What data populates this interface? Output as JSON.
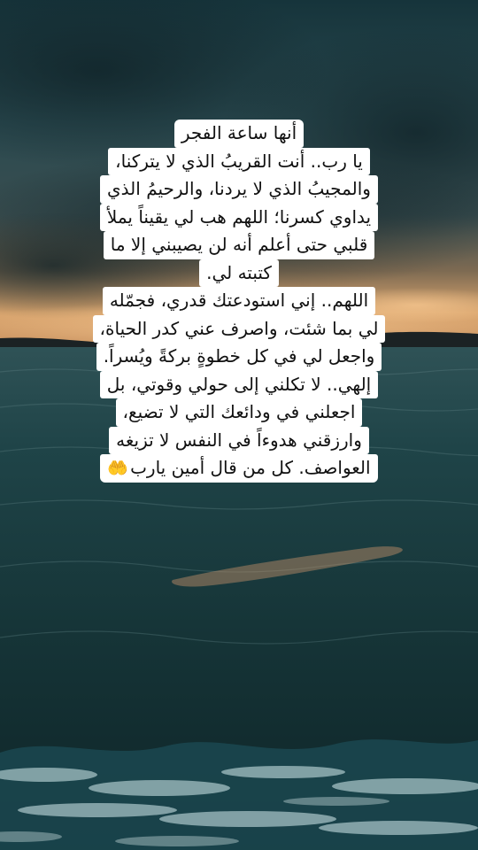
{
  "caption": {
    "lines": [
      "أنها ساعة الفجر",
      "يا رب.. أنت القريبُ الذي لا يتركنا،",
      "والمجيبُ الذي لا يردنا، والرحيمُ الذي",
      "يداوي كسرنا؛ اللهم هب لي يقيناً يملأ",
      "قلبي حتى أعلم أنه لن يصيبني إلا ما",
      "كتبته لي.",
      "اللهم.. إني استودعتك قدري، فجمّله",
      "لي بما شئت، واصرف عني كدر الحياة،",
      "واجعل لي في كل خطوةٍ بركةً ويُسراً.",
      "إلهي.. لا تكلني إلى حولي وقوتي، بل",
      "اجعلني في ودائعك التي لا تضيع،",
      "وارزقني هدوءاً في النفس لا تزيغه",
      "العواصف. كل من قال أمين يارب"
    ],
    "emoji_icon": "palms-up-together-icon",
    "emoji_char": "🤲",
    "emoji_color": "#f2c21b"
  },
  "colors": {
    "caption_background": "#ffffff",
    "caption_text": "#111111",
    "sky_top": "#1d3c42",
    "sunset_glow": "#e7b27a",
    "sea": "#16393e"
  }
}
